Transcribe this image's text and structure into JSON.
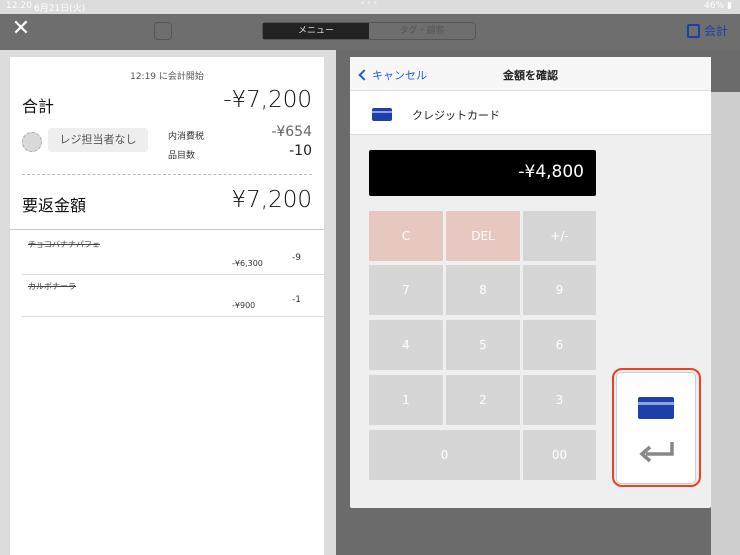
{
  "status_bar": {
    "time": "12:20",
    "date": "6月21日(火)",
    "battery": "46%"
  },
  "top_nav": {
    "tabs": [
      {
        "label": "メニュー"
      },
      {
        "label": "タグ・顧客"
      }
    ],
    "checkout_label": "会計"
  },
  "receipt": {
    "start_time": "12:19 に会計開始",
    "total_label": "合計",
    "total_amount": "-¥7,200",
    "cashier_label": "レジ担当者なし",
    "tax_label": "内消費税",
    "tax_amount": "-¥654",
    "item_count_label": "品目数",
    "item_count": "-10",
    "refund_label": "要返金額",
    "refund_amount": "¥7,200",
    "items": [
      {
        "name": "チョコバナナパフェ",
        "price": "-¥6,300",
        "qty": "-9"
      },
      {
        "name": "カルボナーラ",
        "price": "-¥900",
        "qty": "-1"
      }
    ]
  },
  "modal": {
    "cancel_label": "キャンセル",
    "title": "金額を確認",
    "payment_method": "クレジットカード",
    "display_value": "-¥4,800",
    "keys": {
      "clear": "C",
      "del": "DEL",
      "sign": "+/-",
      "k7": "7",
      "k8": "8",
      "k9": "9",
      "k4": "4",
      "k5": "5",
      "k6": "6",
      "k1": "1",
      "k2": "2",
      "k3": "3",
      "k0": "0",
      "k00": "00"
    }
  },
  "colors": {
    "accent": "#1e3faa",
    "link": "#1e5fd8",
    "highlight": "#f04020"
  }
}
